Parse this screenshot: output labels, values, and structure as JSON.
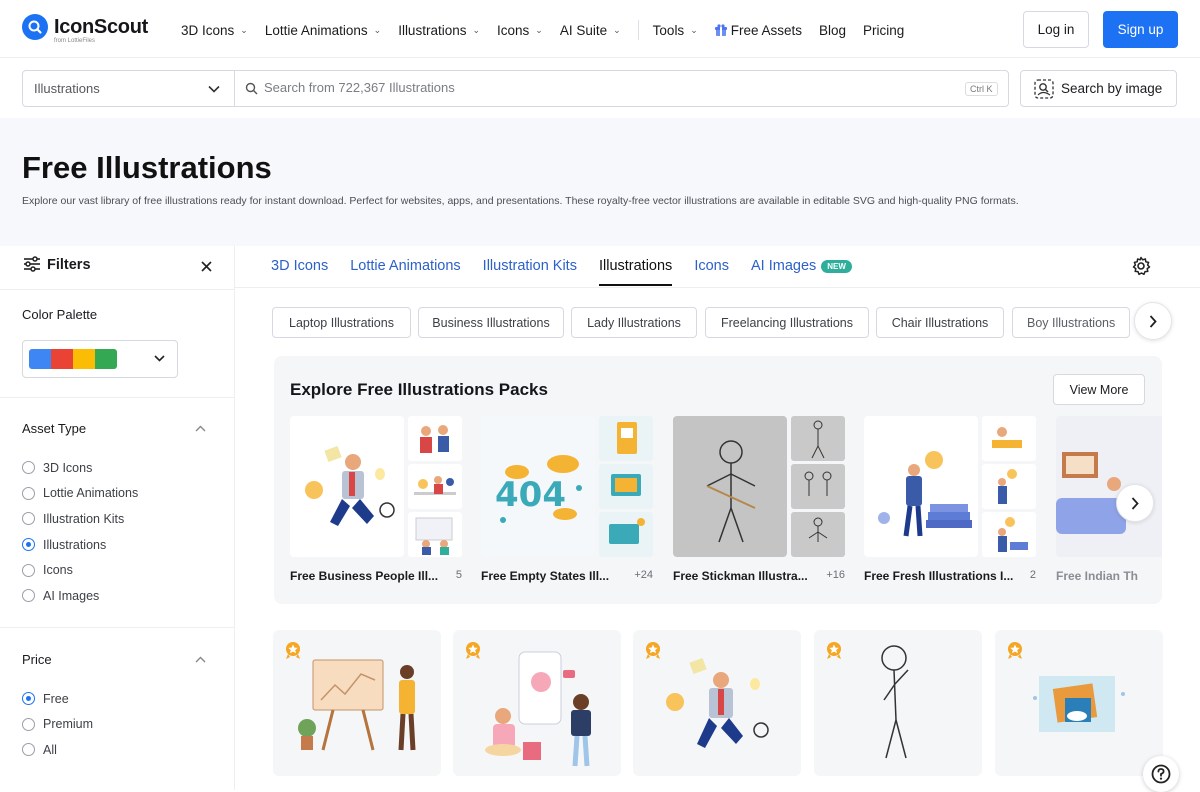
{
  "brand": {
    "name": "IconScout",
    "sub": "from LottieFiles",
    "accent": "#1d72f3"
  },
  "nav": {
    "items": [
      {
        "label": "3D Icons"
      },
      {
        "label": "Lottie Animations"
      },
      {
        "label": "Illustrations"
      },
      {
        "label": "Icons"
      },
      {
        "label": "AI Suite"
      }
    ],
    "tools": "Tools",
    "free_assets": "Free Assets",
    "blog": "Blog",
    "pricing": "Pricing",
    "login": "Log in",
    "signup": "Sign up"
  },
  "search": {
    "category": "Illustrations",
    "placeholder": "Search from 722,367 Illustrations",
    "shortcut": "Ctrl K",
    "by_image": "Search by image"
  },
  "hero": {
    "title": "Free Illustrations",
    "description": "Explore our vast library of free illustrations ready for instant download. Perfect for websites, apps, and presentations. These royalty-free vector illustrations are available in editable SVG and high-quality PNG formats."
  },
  "filters": {
    "title": "Filters",
    "color_palette": "Color Palette",
    "palette_colors": [
      "#3f86f5",
      "#ea4335",
      "#fbbc05",
      "#34a853"
    ],
    "asset_type": {
      "title": "Asset Type",
      "options": [
        "3D Icons",
        "Lottie Animations",
        "Illustration Kits",
        "Illustrations",
        "Icons",
        "AI Images"
      ],
      "selected": "Illustrations"
    },
    "price": {
      "title": "Price",
      "options": [
        "Free",
        "Premium",
        "All"
      ],
      "selected": "Free"
    }
  },
  "tabs": {
    "items": [
      "3D Icons",
      "Lottie Animations",
      "Illustration Kits",
      "Illustrations",
      "Icons",
      "AI Images"
    ],
    "active": "Illustrations",
    "new_badge": "NEW"
  },
  "chips": [
    "Laptop Illustrations",
    "Business Illustrations",
    "Lady Illustrations",
    "Freelancing Illustrations",
    "Chair Illustrations",
    "Boy Illustrations"
  ],
  "packs": {
    "title": "Explore Free Illustrations Packs",
    "view_more": "View More",
    "items": [
      {
        "name": "Free Business People Ill...",
        "count": "5"
      },
      {
        "name": "Free Empty States Ill...",
        "count": "+24"
      },
      {
        "name": "Free Stickman Illustra...",
        "count": "+16"
      },
      {
        "name": "Free Fresh Illustrations I...",
        "count": "2"
      },
      {
        "name": "Free Indian Th",
        "count": ""
      }
    ]
  }
}
